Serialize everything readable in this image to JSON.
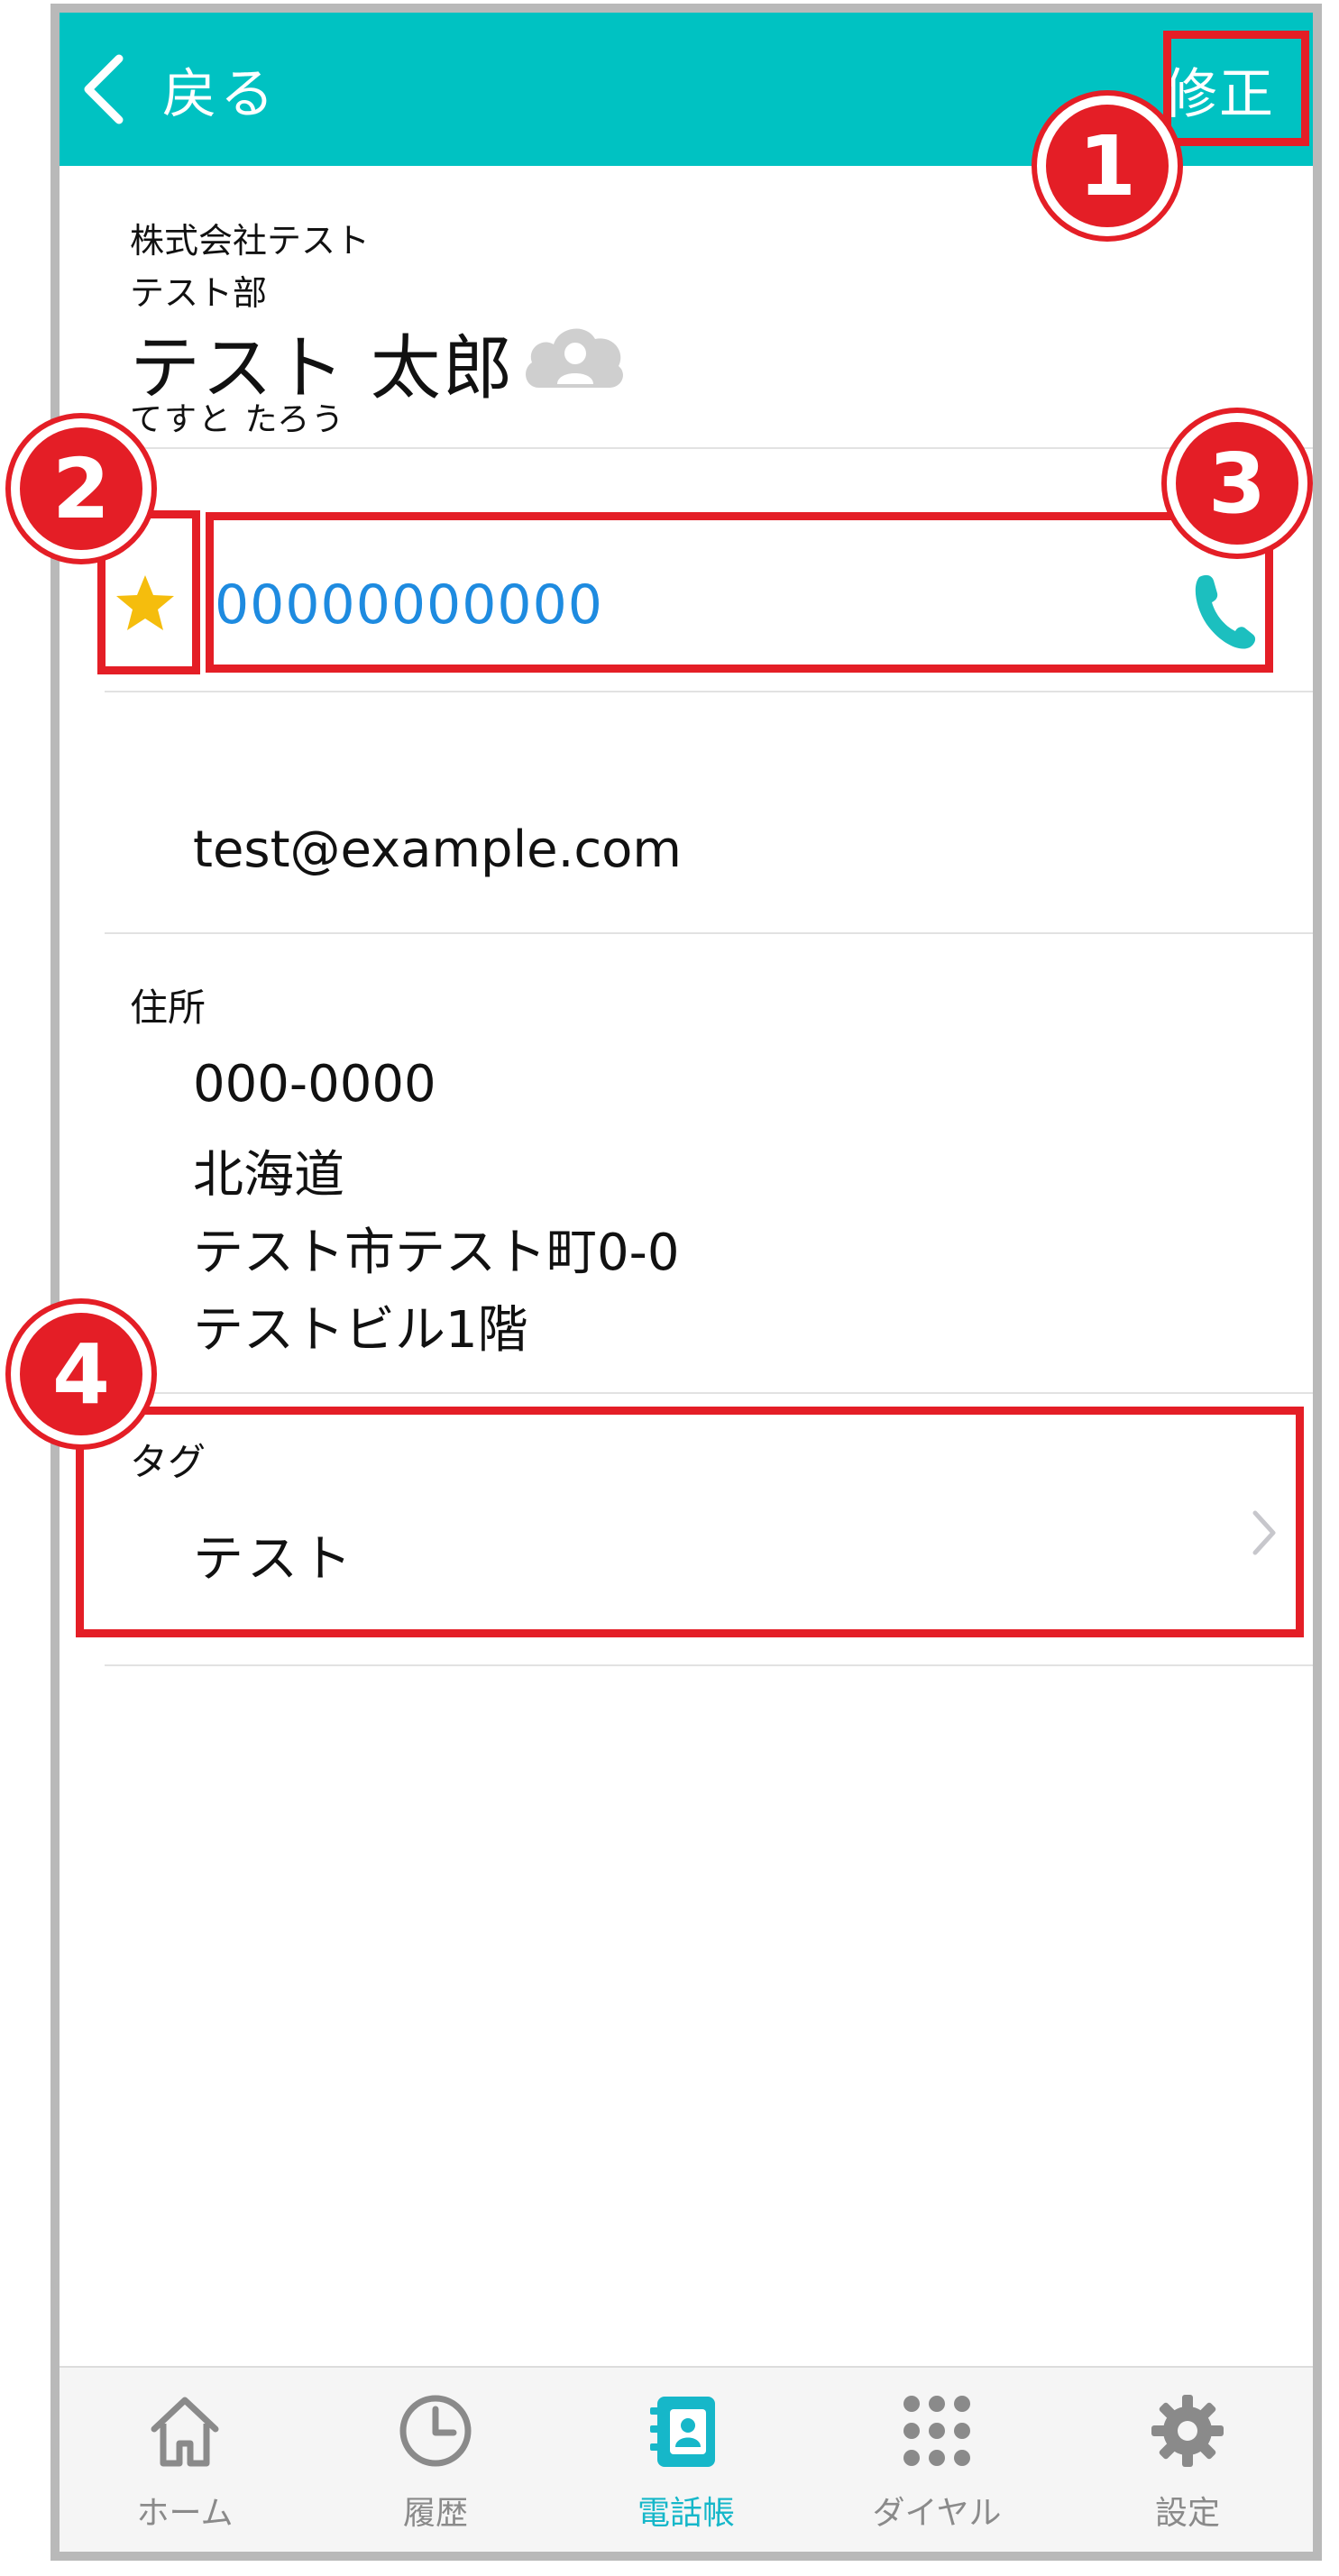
{
  "header": {
    "back_label": "戻る",
    "edit_label": "修正"
  },
  "contact": {
    "company": "株式会社テスト",
    "department": "テスト部",
    "name": "テスト 太郎",
    "furigana": "てすと たろう",
    "phone": "00000000000",
    "phone_favorite": true,
    "email": "test@example.com",
    "address_label": "住所",
    "address_lines": [
      "000-0000",
      "北海道",
      "テスト市テスト町0-0",
      "テストビル1階"
    ],
    "tag_label": "タグ",
    "tag_value": "テスト"
  },
  "annotations": [
    "1",
    "2",
    "3",
    "4"
  ],
  "tabbar": {
    "tabs": [
      {
        "label": "ホーム",
        "icon": "home-icon"
      },
      {
        "label": "履歴",
        "icon": "clock-icon"
      },
      {
        "label": "電話帳",
        "icon": "phonebook-icon"
      },
      {
        "label": "ダイヤル",
        "icon": "dialpad-icon"
      },
      {
        "label": "設定",
        "icon": "gear-icon"
      }
    ],
    "active_tab": "電話帳"
  },
  "colors": {
    "header_bg": "#00c2c2",
    "link_blue": "#1e8be0",
    "star_yellow": "#f5bd0d",
    "call_teal": "#1cbfbf",
    "annotation_red": "#e41e26",
    "tab_active": "#16b7c9",
    "tab_inactive": "#8a8a8a"
  }
}
